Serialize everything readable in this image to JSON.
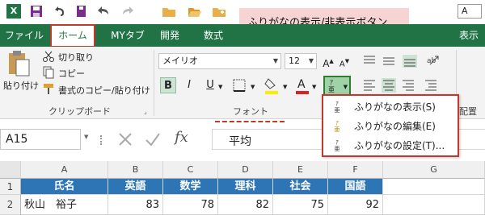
{
  "ribbon_tabs": {
    "file": "ファイル",
    "home": "ホーム",
    "my": "MYタブ",
    "dev": "開発",
    "formula": "数式",
    "view": "表示"
  },
  "clipboard": {
    "paste": "貼り付け",
    "cut": "切り取り",
    "copy": "コピー",
    "format_painter": "書式のコピー/貼り付け",
    "group": "クリップボード"
  },
  "font": {
    "name": "メイリオ",
    "size": "12",
    "group": "フォント",
    "bold": "B",
    "italic": "I",
    "underline": "U"
  },
  "align_group": "配置",
  "callout": "ふりがなの表示/非表示ボタン",
  "furigana_menu": [
    {
      "label": "ふりがなの表示(S)",
      "key": "S"
    },
    {
      "label": "ふりがなの編集(E)",
      "key": "E"
    },
    {
      "label": "ふりがなの設定(T)...",
      "key": "T"
    }
  ],
  "formula_bar": {
    "name_box": "A15",
    "fx": "fx",
    "content": "平均"
  },
  "columns": [
    "A",
    "B",
    "C",
    "D",
    "E",
    "F",
    "G"
  ],
  "rows": [
    {
      "num": "1",
      "cells": [
        "氏名",
        "英語",
        "数学",
        "理科",
        "社会",
        "国語"
      ]
    },
    {
      "num": "2",
      "cells": [
        "秋山　裕子",
        "83",
        "78",
        "82",
        "75",
        "92"
      ]
    }
  ],
  "colors": {
    "excel_green": "#217346",
    "header_blue": "#2e75b6",
    "highlight_red": "#c0392b"
  }
}
